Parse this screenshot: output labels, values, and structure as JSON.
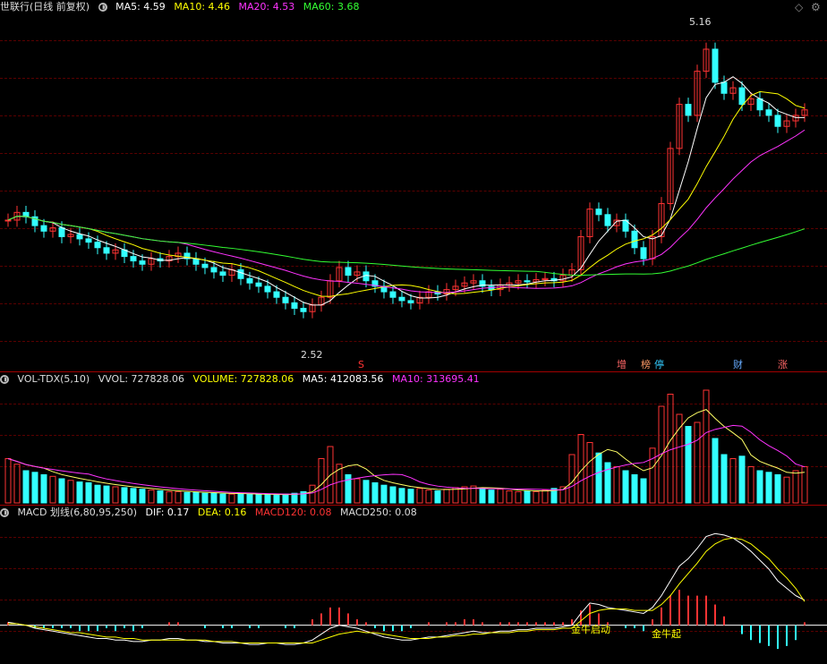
{
  "main": {
    "title": "世联行(日线 前复权)",
    "ma5": "MA5: 4.59",
    "ma10": "MA10: 4.46",
    "ma20": "MA20: 4.53",
    "ma60": "MA60: 3.68",
    "high_label": "5.16",
    "low_label": "2.52",
    "marker_s": "S",
    "tags": [
      "增",
      "榜",
      "停",
      "财",
      "涨"
    ],
    "colors": {
      "ma5": "#ffffff",
      "ma10": "#ffff00",
      "ma20": "#ff33ff",
      "ma60": "#33ff33",
      "up": "#ff3333",
      "down": "#33ffff"
    }
  },
  "vol": {
    "title": "VOL-TDX(5,10)",
    "vvol": "VVOL: 727828.06",
    "volume": "VOLUME: 727828.06",
    "ma5": "MA5: 412083.56",
    "ma10": "MA10: 313695.41"
  },
  "macd": {
    "title": "MACD 划线(6,80,95,250)",
    "dif": "DIF: 0.17",
    "dea": "DEA: 0.16",
    "macd120": "MACD120: 0.08",
    "macd250": "MACD250: 0.08",
    "signal1": "金牛启动",
    "signal2": "金牛起"
  },
  "chart_data": {
    "type": "candlestick",
    "closes": [
      3.55,
      3.62,
      3.58,
      3.5,
      3.45,
      3.48,
      3.4,
      3.42,
      3.38,
      3.35,
      3.3,
      3.25,
      3.28,
      3.22,
      3.18,
      3.15,
      3.2,
      3.18,
      3.22,
      3.25,
      3.2,
      3.15,
      3.12,
      3.08,
      3.05,
      3.1,
      3.02,
      2.98,
      2.95,
      2.9,
      2.85,
      2.8,
      2.75,
      2.72,
      2.78,
      2.85,
      3.0,
      3.12,
      3.05,
      3.08,
      3.0,
      2.95,
      2.9,
      2.85,
      2.82,
      2.8,
      2.85,
      2.9,
      2.88,
      2.92,
      2.95,
      2.98,
      3.0,
      2.95,
      2.92,
      2.96,
      2.98,
      3.0,
      2.99,
      3.01,
      3.02,
      3.0,
      3.05,
      3.1,
      3.4,
      3.65,
      3.6,
      3.5,
      3.55,
      3.45,
      3.3,
      3.2,
      3.4,
      3.7,
      4.2,
      4.6,
      4.5,
      4.9,
      5.1,
      4.8,
      4.7,
      4.75,
      4.6,
      4.65,
      4.55,
      4.5,
      4.4,
      4.45,
      4.5,
      4.55
    ],
    "volume": [
      55,
      48,
      40,
      38,
      35,
      33,
      30,
      28,
      26,
      25,
      22,
      21,
      20,
      19,
      18,
      17,
      16,
      15,
      14,
      14,
      13,
      13,
      12,
      12,
      11,
      11,
      12,
      11,
      10,
      10,
      10,
      11,
      12,
      14,
      22,
      55,
      70,
      48,
      35,
      30,
      28,
      25,
      22,
      20,
      18,
      17,
      18,
      16,
      15,
      17,
      19,
      20,
      21,
      18,
      16,
      17,
      15,
      14,
      15,
      14,
      16,
      18,
      20,
      60,
      85,
      75,
      62,
      50,
      45,
      40,
      35,
      30,
      68,
      120,
      135,
      110,
      95,
      100,
      140,
      80,
      60,
      55,
      58,
      45,
      40,
      38,
      35,
      32,
      40,
      45
    ],
    "dif": [
      0.02,
      0.01,
      0.0,
      -0.02,
      -0.03,
      -0.04,
      -0.05,
      -0.06,
      -0.07,
      -0.08,
      -0.09,
      -0.09,
      -0.1,
      -0.1,
      -0.11,
      -0.11,
      -0.1,
      -0.1,
      -0.09,
      -0.09,
      -0.1,
      -0.1,
      -0.11,
      -0.11,
      -0.12,
      -0.12,
      -0.12,
      -0.13,
      -0.13,
      -0.12,
      -0.12,
      -0.13,
      -0.13,
      -0.12,
      -0.1,
      -0.06,
      -0.02,
      0.0,
      -0.01,
      -0.02,
      -0.04,
      -0.06,
      -0.08,
      -0.09,
      -0.1,
      -0.1,
      -0.09,
      -0.08,
      -0.08,
      -0.07,
      -0.06,
      -0.05,
      -0.04,
      -0.05,
      -0.05,
      -0.04,
      -0.04,
      -0.03,
      -0.03,
      -0.02,
      -0.02,
      -0.02,
      -0.01,
      0.0,
      0.08,
      0.15,
      0.14,
      0.12,
      0.11,
      0.1,
      0.09,
      0.08,
      0.12,
      0.2,
      0.3,
      0.4,
      0.45,
      0.52,
      0.6,
      0.62,
      0.61,
      0.59,
      0.55,
      0.5,
      0.44,
      0.38,
      0.3,
      0.25,
      0.2,
      0.17
    ],
    "dea": [
      0.01,
      0.01,
      0.0,
      -0.01,
      -0.02,
      -0.03,
      -0.04,
      -0.05,
      -0.05,
      -0.06,
      -0.07,
      -0.08,
      -0.08,
      -0.09,
      -0.09,
      -0.1,
      -0.1,
      -0.1,
      -0.1,
      -0.1,
      -0.1,
      -0.1,
      -0.1,
      -0.11,
      -0.11,
      -0.11,
      -0.12,
      -0.12,
      -0.12,
      -0.12,
      -0.12,
      -0.12,
      -0.12,
      -0.12,
      -0.12,
      -0.1,
      -0.08,
      -0.06,
      -0.05,
      -0.04,
      -0.05,
      -0.05,
      -0.06,
      -0.07,
      -0.08,
      -0.09,
      -0.09,
      -0.09,
      -0.08,
      -0.08,
      -0.07,
      -0.07,
      -0.06,
      -0.06,
      -0.05,
      -0.05,
      -0.05,
      -0.04,
      -0.04,
      -0.03,
      -0.03,
      -0.03,
      -0.02,
      -0.02,
      0.03,
      0.08,
      0.1,
      0.11,
      0.11,
      0.11,
      0.1,
      0.1,
      0.1,
      0.14,
      0.2,
      0.28,
      0.35,
      0.42,
      0.5,
      0.55,
      0.58,
      0.59,
      0.58,
      0.55,
      0.5,
      0.45,
      0.38,
      0.32,
      0.25,
      0.16
    ],
    "ylim_price": [
      2.3,
      5.4
    ],
    "ylim_macd": [
      -0.25,
      0.7
    ]
  }
}
